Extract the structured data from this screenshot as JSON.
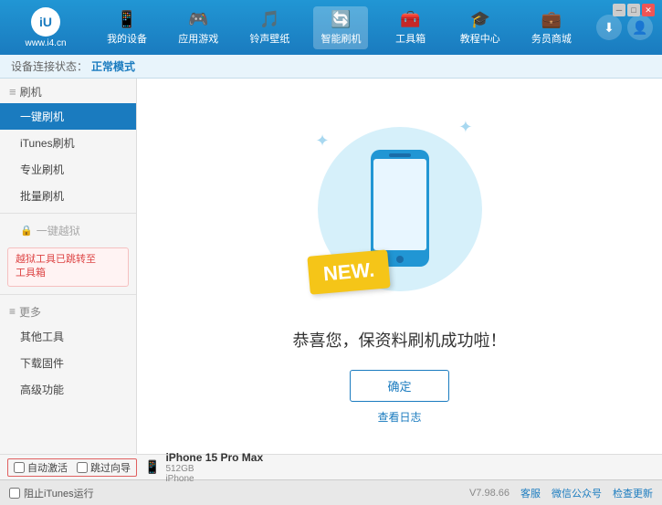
{
  "app": {
    "logo_text": "www.i4.cn",
    "logo_inner": "iU"
  },
  "nav": {
    "items": [
      {
        "id": "my-device",
        "icon": "📱",
        "label": "我的设备"
      },
      {
        "id": "apps-games",
        "icon": "🎮",
        "label": "应用游戏"
      },
      {
        "id": "ringtones",
        "icon": "🎵",
        "label": "铃声壁纸"
      },
      {
        "id": "smart-flash",
        "icon": "🔄",
        "label": "智能刷机",
        "active": true
      },
      {
        "id": "toolbox",
        "icon": "🧰",
        "label": "工具箱"
      },
      {
        "id": "tutorial",
        "icon": "🎓",
        "label": "教程中心"
      },
      {
        "id": "service",
        "icon": "💼",
        "label": "务员商城"
      }
    ]
  },
  "header_right": {
    "download_icon": "⬇",
    "user_icon": "👤"
  },
  "status_bar": {
    "prefix": "设备连接状态：",
    "value": "正常模式"
  },
  "sidebar": {
    "flash_section": "刷机",
    "items": [
      {
        "id": "one-key-flash",
        "label": "一键刷机",
        "active": true
      },
      {
        "id": "itunes-flash",
        "label": "iTunes刷机"
      },
      {
        "id": "pro-flash",
        "label": "专业刷机"
      },
      {
        "id": "batch-flash",
        "label": "批量刷机"
      }
    ],
    "disabled_section": "一键越狱",
    "notice": "越狱工具已跳转至\n工具箱",
    "more_section": "更多",
    "more_items": [
      {
        "id": "other-tools",
        "label": "其他工具"
      },
      {
        "id": "download-firmware",
        "label": "下载固件"
      },
      {
        "id": "advanced",
        "label": "高级功能"
      }
    ]
  },
  "content": {
    "new_badge": "NEW.",
    "success_text": "恭喜您，保资料刷机成功啦！",
    "confirm_btn": "确定",
    "log_link": "查看日志"
  },
  "device_bar": {
    "auto_activate_label": "自动激活",
    "auto_guide_label": "跳过向导",
    "device_name": "iPhone 15 Pro Max",
    "device_storage": "512GB",
    "device_type": "iPhone"
  },
  "footer": {
    "itunes_label": "阻止iTunes运行",
    "version": "V7.98.66",
    "desktop_label": "客服",
    "wechat_label": "微信公众号",
    "check_update_label": "检查更新"
  },
  "win_controls": {
    "minimize": "─",
    "maximize": "□",
    "close": "✕"
  }
}
